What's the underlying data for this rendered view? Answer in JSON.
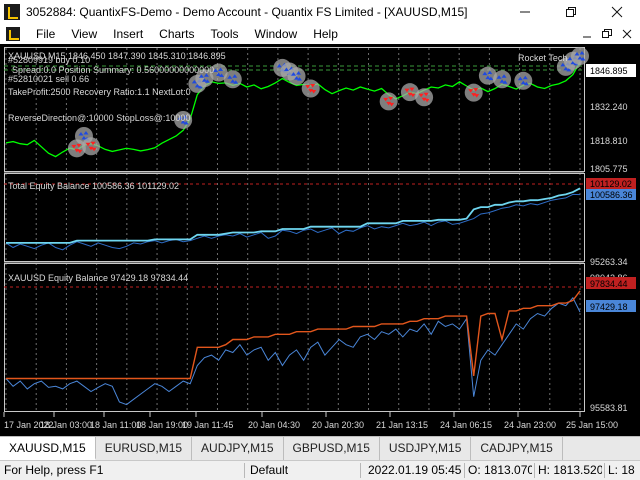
{
  "window": {
    "title": "3052884: QuantixFS-Demo - Demo Account - Quantix FS Limited - [XAUUSD,M15]",
    "minimize_icon": "minimize-icon",
    "maximize_icon": "restore-icon",
    "close_icon": "close-icon"
  },
  "menu": {
    "items": [
      "File",
      "View",
      "Insert",
      "Charts",
      "Tools",
      "Window",
      "Help"
    ]
  },
  "colors": {
    "price_line": "#00ff00",
    "equity_total": "#6fd6f0",
    "equity_total_dark": "#2d6bc4",
    "equity_xau": "#e2561c",
    "equity_xau_dark": "#4a86d8",
    "marker_buy": "#1f4ae0",
    "marker_sell": "#ff2020",
    "grid": "#c8c8c8"
  },
  "panel_price": {
    "header": "XAUUSD,M15  1846.450 1847.390 1845.310 1846.895",
    "info_lines": [
      "#52809919 buy 0.10",
      "Spread:0.0 Position Summary: 0.56000000000000",
      "#52810021 sell 0.66",
      "TakeProfit:2500 Recovery Ratio:1.1 NextLot:0",
      "ReverseDirection@:10000 StopLoss@:10000"
    ],
    "expert_name": "Rocket Tech",
    "current_price": "1846.895",
    "price_labels": [
      "1832.240",
      "1818.810",
      "1805.775"
    ],
    "chart_data": {
      "type": "line",
      "series_name": "XAUUSD,M15",
      "ylim": [
        1805.775,
        1850
      ],
      "values": [
        1815.5,
        1816.0,
        1815.2,
        1814.8,
        1816.5,
        1814.0,
        1811.5,
        1810.2,
        1812.0,
        1813.5,
        1812.8,
        1814.6,
        1815.2,
        1814.4,
        1813.0,
        1812.2,
        1812.8,
        1813.4,
        1813.0,
        1812.4,
        1812.9,
        1813.6,
        1815.4,
        1816.8,
        1818.2,
        1820.4,
        1824.8,
        1834.2,
        1837.6,
        1839.2,
        1838.6,
        1838.8,
        1837.8,
        1838.6,
        1837.2,
        1838.0,
        1836.5,
        1837.4,
        1838.8,
        1840.5,
        1839.0,
        1837.8,
        1838.2,
        1837.6,
        1838.4,
        1836.2,
        1834.6,
        1835.8,
        1836.8,
        1836.0,
        1837.2,
        1836.4,
        1835.6,
        1836.6,
        1834.2,
        1832.6,
        1833.8,
        1835.2,
        1834.6,
        1836.0,
        1837.2,
        1836.8,
        1838.0,
        1837.4,
        1839.2,
        1837.6,
        1836.0,
        1836.8,
        1835.4,
        1836.6,
        1838.2,
        1837.4,
        1836.4,
        1837.8,
        1838.6,
        1837.2,
        1836.6,
        1837.8,
        1838.4,
        1839.6,
        1842.0,
        1846.9
      ]
    },
    "markers": [
      {
        "i": 11,
        "type": "buy",
        "price": 1818.2
      },
      {
        "i": 10,
        "type": "sell",
        "price": 1813.4
      },
      {
        "i": 12,
        "type": "sell",
        "price": 1814.2
      },
      {
        "i": 27,
        "type": "buy",
        "price": 1838.4
      },
      {
        "i": 28,
        "type": "buy",
        "price": 1840.6
      },
      {
        "i": 25,
        "type": "buy",
        "price": 1824.4
      },
      {
        "i": 30,
        "type": "buy",
        "price": 1842.8
      },
      {
        "i": 32,
        "type": "buy",
        "price": 1840.2
      },
      {
        "i": 39,
        "type": "buy",
        "price": 1844.6
      },
      {
        "i": 40,
        "type": "buy",
        "price": 1843.2
      },
      {
        "i": 41,
        "type": "buy",
        "price": 1841.4
      },
      {
        "i": 43,
        "type": "sell",
        "price": 1836.6
      },
      {
        "i": 54,
        "type": "sell",
        "price": 1831.6
      },
      {
        "i": 57,
        "type": "sell",
        "price": 1835.2
      },
      {
        "i": 59,
        "type": "sell",
        "price": 1833.2
      },
      {
        "i": 66,
        "type": "sell",
        "price": 1835.0
      },
      {
        "i": 68,
        "type": "buy",
        "price": 1841.6
      },
      {
        "i": 70,
        "type": "buy",
        "price": 1840.2
      },
      {
        "i": 73,
        "type": "buy",
        "price": 1839.6
      },
      {
        "i": 79,
        "type": "buy",
        "price": 1845.0
      },
      {
        "i": 80,
        "type": "buy",
        "price": 1847.4
      },
      {
        "i": 81,
        "type": "buy",
        "price": 1849.2
      }
    ]
  },
  "panel_equity_total": {
    "header": "Total Equity Balance 100586.36 101129.02",
    "current_label_top": "101129.02",
    "current_label_bottom": "100586.36",
    "bottom_label": "95263.34",
    "chart_data": {
      "type": "line",
      "ylim": [
        95263.34,
        101500
      ],
      "series": [
        {
          "name": "Equity",
          "values": [
            96400,
            96400,
            96400,
            96400,
            96400,
            96400,
            96400,
            96400,
            96400,
            96400,
            96600,
            96600,
            96600,
            96600,
            96600,
            96600,
            96600,
            96600,
            96600,
            96600,
            96600,
            96700,
            96700,
            96700,
            96700,
            96700,
            96700,
            97100,
            97100,
            97100,
            97100,
            97200,
            97300,
            97300,
            97300,
            97300,
            97400,
            97400,
            97400,
            97600,
            97600,
            97600,
            97600,
            97800,
            97800,
            97800,
            97800,
            97800,
            97800,
            97800,
            97800,
            98100,
            98100,
            98100,
            98100,
            98100,
            98300,
            98300,
            98300,
            98300,
            98300,
            98400,
            98400,
            98400,
            98400,
            98500,
            99300,
            99500,
            99500,
            99700,
            99700,
            99900,
            100000,
            100000,
            100100,
            100100,
            100200,
            100300,
            100500,
            100600,
            100800,
            101129
          ]
        },
        {
          "name": "Balance",
          "values": [
            96400,
            96000,
            96300,
            96100,
            95900,
            96200,
            96400,
            96000,
            95800,
            96200,
            96500,
            96300,
            96100,
            96400,
            96200,
            96000,
            95900,
            96100,
            96400,
            96300,
            96500,
            96600,
            96400,
            96600,
            96700,
            96500,
            96600,
            96800,
            97000,
            96800,
            97000,
            97100,
            97000,
            97200,
            96900,
            97100,
            97300,
            96800,
            97000,
            97500,
            97400,
            97200,
            97500,
            97600,
            97300,
            97500,
            97700,
            97200,
            97500,
            97400,
            97700,
            97900,
            97600,
            97800,
            97700,
            97900,
            98100,
            97900,
            98000,
            98200,
            97900,
            98200,
            98300,
            98000,
            98100,
            98300,
            98500,
            98900,
            99000,
            99200,
            99400,
            99500,
            99700,
            99600,
            99800,
            99700,
            99900,
            100100,
            100200,
            100300,
            100600,
            100586
          ]
        }
      ]
    }
  },
  "panel_equity_xau": {
    "header": "XAUUSD Equity Balance 97429.18 97834.44",
    "top_label": "98042.86",
    "current_label_top": "97834.44",
    "current_label_bottom": "97429.18",
    "bottom_label": "95583.81",
    "chart_data": {
      "type": "line",
      "ylim": [
        95583.81,
        98042.86
      ],
      "series": [
        {
          "name": "Equity",
          "values": [
            96150,
            96150,
            96150,
            96150,
            96150,
            96150,
            96150,
            96150,
            96150,
            96150,
            96150,
            96150,
            96150,
            96150,
            96150,
            96150,
            96150,
            96150,
            96150,
            96150,
            96150,
            96150,
            96150,
            96150,
            96150,
            96150,
            96150,
            96750,
            96750,
            96750,
            96750,
            96800,
            96900,
            96900,
            96900,
            96950,
            96950,
            96950,
            97000,
            97000,
            97000,
            97050,
            97050,
            97050,
            97100,
            97100,
            97100,
            97100,
            97100,
            97150,
            97150,
            97150,
            97150,
            97200,
            97200,
            97200,
            97200,
            97250,
            97250,
            97300,
            97300,
            97300,
            97350,
            97350,
            97350,
            97350,
            96200,
            97350,
            97400,
            97400,
            96900,
            97450,
            97450,
            97500,
            97500,
            97550,
            97550,
            97550,
            97600,
            97600,
            97650,
            97834
          ]
        },
        {
          "name": "Balance",
          "values": [
            96150,
            96000,
            96100,
            95950,
            96050,
            96100,
            95980,
            96000,
            95950,
            96050,
            96100,
            96000,
            95900,
            95980,
            96050,
            96000,
            95700,
            95650,
            95750,
            95850,
            95950,
            96050,
            96000,
            95900,
            96000,
            96100,
            96050,
            96400,
            96550,
            96600,
            96500,
            96700,
            96650,
            96800,
            96600,
            96700,
            96750,
            96500,
            96650,
            96400,
            96600,
            96700,
            96500,
            96750,
            96850,
            96600,
            96750,
            96900,
            96800,
            96750,
            96950,
            97000,
            96900,
            97050,
            97000,
            97100,
            96950,
            97100,
            97050,
            97200,
            97000,
            97250,
            97150,
            97200,
            97100,
            97300,
            95800,
            96500,
            96700,
            96600,
            96800,
            97000,
            97200,
            97100,
            97300,
            97400,
            97350,
            97500,
            97600,
            97550,
            97700,
            97429
          ]
        }
      ]
    }
  },
  "time_axis": {
    "labels": [
      "17 Jan 2022",
      "18 Jan 03:00",
      "18 Jan 11:00",
      "18 Jan 19:00",
      "19 Jan 11:45",
      "20 Jan 04:30",
      "20 Jan 20:30",
      "21 Jan 13:15",
      "24 Jan 06:15",
      "24 Jan 23:00",
      "25 Jan 15:00"
    ]
  },
  "symbol_tabs": [
    "XAUUSD,M15",
    "EURUSD,M15",
    "AUDJPY,M15",
    "GBPUSD,M15",
    "USDJPY,M15",
    "CADJPY,M15"
  ],
  "active_tab": "XAUUSD,M15",
  "status": {
    "help": "For Help, press F1",
    "profile": "Default",
    "datetime": "2022.01.19 05:45",
    "open": "O: 1813.070",
    "high": "H: 1813.520",
    "low": "L: 18"
  }
}
